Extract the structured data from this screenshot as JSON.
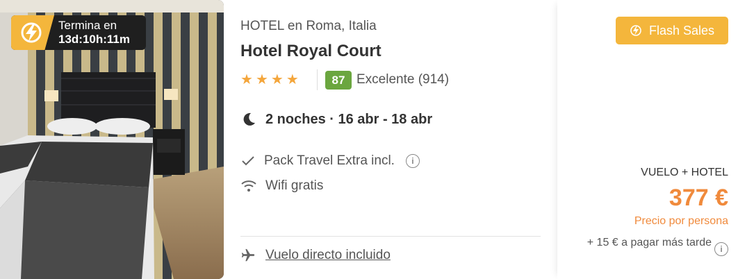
{
  "timer": {
    "label": "Termina en",
    "countdown": "13d:10h:11m",
    "icon": "flash-bolt-icon"
  },
  "hotel": {
    "location": "HOTEL en Roma, Italia",
    "name": "Hotel Royal Court",
    "stars": 4,
    "score": "87",
    "rating_text": "Excelente (914)"
  },
  "stay": {
    "nights_text": "2 noches · 16 abr - 18 abr"
  },
  "features": [
    {
      "icon": "check-icon",
      "label": "Pack Travel Extra incl.",
      "info": true
    },
    {
      "icon": "wifi-icon",
      "label": "Wifi gratis",
      "info": false
    }
  ],
  "flight": {
    "label": "Vuelo directo incluido"
  },
  "price": {
    "badge": "Flash Sales",
    "package": "VUELO + HOTEL",
    "amount": "377 €",
    "per_person": "Precio por persona",
    "extra": "+ 15 € a pagar más tarde"
  },
  "colors": {
    "accent_yellow": "#f4b63c",
    "price_orange": "#f08a3c",
    "score_green": "#6ba63f"
  }
}
